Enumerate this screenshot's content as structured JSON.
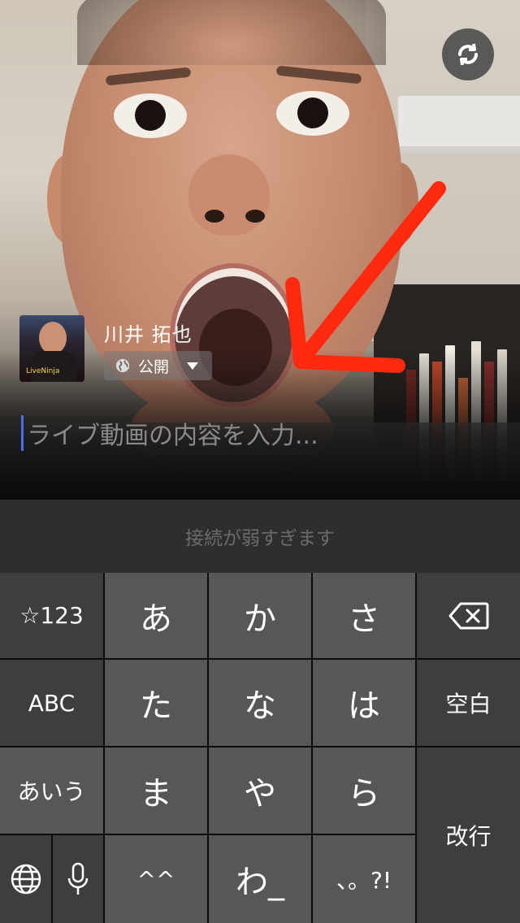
{
  "camera": {
    "switch_icon": "camera-switch-icon"
  },
  "profile": {
    "name": "川井 拓也",
    "avatar_text": "LiveNinja",
    "privacy_label": "公開",
    "privacy_icon": "globe-icon"
  },
  "compose": {
    "placeholder": "ライブ動画の内容を入力..."
  },
  "status": {
    "message": "接続が弱すぎます"
  },
  "keyboard": {
    "row1": [
      "☆123",
      "あ",
      "か",
      "さ"
    ],
    "row2": [
      "ABC",
      "た",
      "な",
      "は"
    ],
    "row3": [
      "あいう",
      "ま",
      "や",
      "ら"
    ],
    "row4": [
      "^^",
      "わ_",
      "、。?!"
    ],
    "space_label": "空白",
    "return_label": "改行",
    "delete_icon": "backspace-icon",
    "globe_icon": "globe-icon",
    "mic_icon": "microphone-icon"
  },
  "annotation": {
    "arrow_color": "#ff2a10"
  }
}
